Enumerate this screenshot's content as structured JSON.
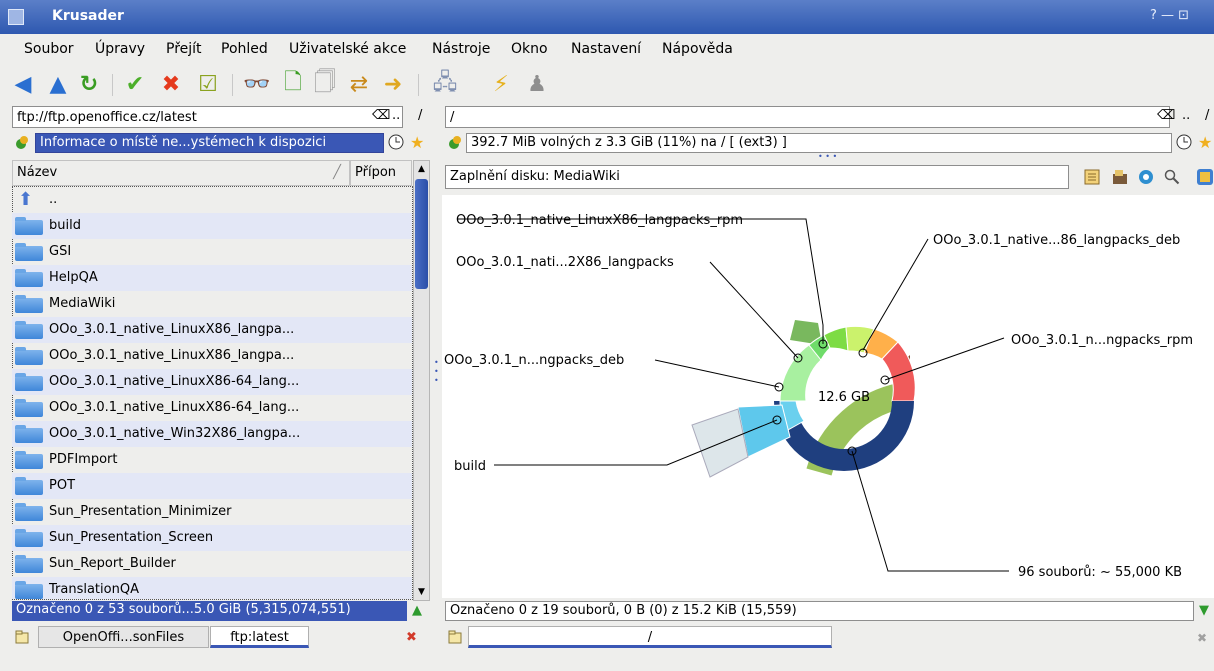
{
  "window": {
    "title": "Krusader",
    "controls": "? — ⊡"
  },
  "menu": [
    "Soubor",
    "Úpravy",
    "Přejít",
    "Pohled",
    "Uživatelské akce",
    "Nástroje",
    "Okno",
    "Nastavení",
    "Nápověda"
  ],
  "left_panel": {
    "path": "ftp://ftp.openoffice.cz/latest",
    "info": "Informace o místě ne...ystémech k dispozici",
    "columns": [
      "Název",
      "Přípon"
    ],
    "up_label": "..",
    "items": [
      "build",
      "GSI",
      "HelpQA",
      "MediaWiki",
      "OOo_3.0.1_native_LinuxX86_langpa...",
      "OOo_3.0.1_native_LinuxX86_langpa...",
      "OOo_3.0.1_native_LinuxX86-64_lang...",
      "OOo_3.0.1_native_LinuxX86-64_lang...",
      "OOo_3.0.1_native_Win32X86_langpa...",
      "PDFImport",
      "POT",
      "Sun_Presentation_Minimizer",
      "Sun_Presentation_Screen",
      "Sun_Report_Builder",
      "TranslationQA"
    ],
    "status": "Označeno 0 z 53 souborů...5.0 GiB (5,315,074,551)",
    "tabs": [
      "OpenOffi...sonFiles",
      "ftp:latest"
    ],
    "separator": "/"
  },
  "right_panel": {
    "path": "/",
    "info": "392.7 MiB volných z 3.3 GiB (11%) na / [ (ext3) ]",
    "diskusage_title": "Zaplnění disku: MediaWiki",
    "status": "Označeno 0 z 19 souborů, 0 B  (0) z 15.2 KiB (15,559)",
    "tab_label": "/",
    "separator": "/",
    "chart_center": "12.6 GB",
    "labels": {
      "rpm": "OOo_3.0.1_native_LinuxX86_langpacks_rpm",
      "deb_top": "OOo_3.0.1_native...86_langpacks_deb",
      "nati": "OOo_3.0.1_nati...2X86_langpacks",
      "rpm_right": "OOo_3.0.1_n...ngpacks_rpm",
      "deb_left": "OOo_3.0.1_n...ngpacks_deb",
      "build": "build",
      "files": "96 souborů: ~ 55,000 KB"
    }
  }
}
